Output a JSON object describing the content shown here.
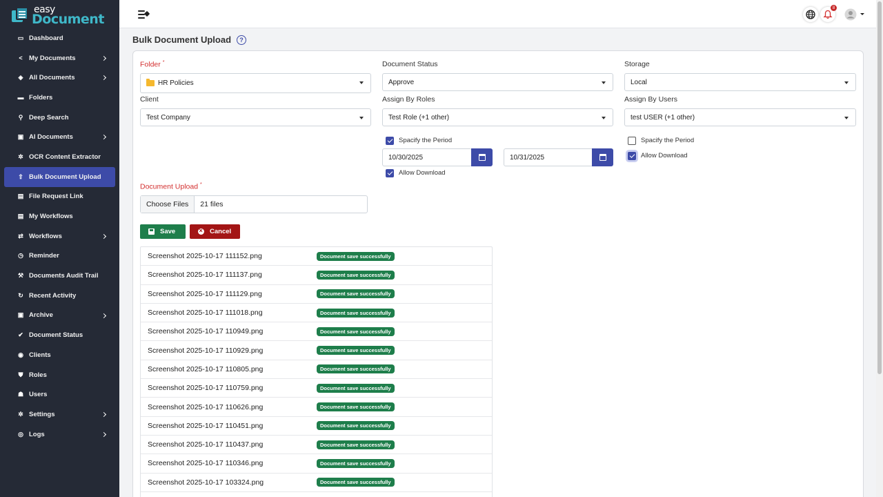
{
  "app": {
    "logo_small": "easy",
    "logo_big": "Document"
  },
  "sidebar": {
    "items": [
      {
        "label": "Dashboard",
        "icon": "monitor-icon",
        "chevron": false
      },
      {
        "label": "My Documents",
        "icon": "share-icon",
        "chevron": true
      },
      {
        "label": "All Documents",
        "icon": "layers-icon",
        "chevron": true
      },
      {
        "label": "Folders",
        "icon": "folder-icon",
        "chevron": false
      },
      {
        "label": "Deep Search",
        "icon": "user-search-icon",
        "chevron": false
      },
      {
        "label": "AI Documents",
        "icon": "ai-document-icon",
        "chevron": true
      },
      {
        "label": "OCR Content Extractor",
        "icon": "gear-icon",
        "chevron": false
      },
      {
        "label": "Bulk Document Upload",
        "icon": "upload-icon",
        "chevron": false,
        "active": true
      },
      {
        "label": "File Request Link",
        "icon": "file-icon",
        "chevron": false
      },
      {
        "label": "My Workflows",
        "icon": "workflow-icon",
        "chevron": false
      },
      {
        "label": "Workflows",
        "icon": "repeat-icon",
        "chevron": true
      },
      {
        "label": "Reminder",
        "icon": "clock-icon",
        "chevron": false
      },
      {
        "label": "Documents Audit Trail",
        "icon": "gavel-icon",
        "chevron": false
      },
      {
        "label": "Recent Activity",
        "icon": "refresh-icon",
        "chevron": false
      },
      {
        "label": "Archive",
        "icon": "archive-icon",
        "chevron": true
      },
      {
        "label": "Document Status",
        "icon": "check-circle-icon",
        "chevron": false
      },
      {
        "label": "Clients",
        "icon": "user-circle-icon",
        "chevron": false
      },
      {
        "label": "Roles",
        "icon": "shield-icon",
        "chevron": false
      },
      {
        "label": "Users",
        "icon": "users-icon",
        "chevron": false
      },
      {
        "label": "Settings",
        "icon": "gear-icon",
        "chevron": true
      },
      {
        "label": "Logs",
        "icon": "eye-icon",
        "chevron": true
      }
    ]
  },
  "topbar": {
    "notification_count": "8"
  },
  "page": {
    "title": "Bulk Document Upload"
  },
  "form": {
    "folder_label": "Folder",
    "folder_value": "HR Policies",
    "status_label": "Document Status",
    "status_value": "Approve",
    "storage_label": "Storage",
    "storage_value": "Local",
    "client_label": "Client",
    "client_value": "Test Company",
    "roles_label": "Assign By Roles",
    "roles_value": "Test Role (+1 other)",
    "users_label": "Assign By Users",
    "users_value": "test USER (+1 other)",
    "roles_period_label": "Spacify the Period",
    "roles_period_checked": true,
    "start_date": "10/30/2025",
    "end_date": "10/31/2025",
    "roles_download_label": "Allow Download",
    "roles_download_checked": true,
    "users_period_label": "Spacify the Period",
    "users_period_checked": false,
    "users_download_label": "Allow Download",
    "users_download_checked": true,
    "upload_label": "Document Upload",
    "choose_files": "Choose Files",
    "files_count": "21 files",
    "required_mark": "*"
  },
  "actions": {
    "save": "Save",
    "cancel": "Cancel"
  },
  "results": [
    {
      "file": "Screenshot 2025-10-17 111152.png",
      "status": "Document save successfully"
    },
    {
      "file": "Screenshot 2025-10-17 111137.png",
      "status": "Document save successfully"
    },
    {
      "file": "Screenshot 2025-10-17 111129.png",
      "status": "Document save successfully"
    },
    {
      "file": "Screenshot 2025-10-17 111018.png",
      "status": "Document save successfully"
    },
    {
      "file": "Screenshot 2025-10-17 110949.png",
      "status": "Document save successfully"
    },
    {
      "file": "Screenshot 2025-10-17 110929.png",
      "status": "Document save successfully"
    },
    {
      "file": "Screenshot 2025-10-17 110805.png",
      "status": "Document save successfully"
    },
    {
      "file": "Screenshot 2025-10-17 110759.png",
      "status": "Document save successfully"
    },
    {
      "file": "Screenshot 2025-10-17 110626.png",
      "status": "Document save successfully"
    },
    {
      "file": "Screenshot 2025-10-17 110451.png",
      "status": "Document save successfully"
    },
    {
      "file": "Screenshot 2025-10-17 110437.png",
      "status": "Document save successfully"
    },
    {
      "file": "Screenshot 2025-10-17 110346.png",
      "status": "Document save successfully"
    },
    {
      "file": "Screenshot 2025-10-17 103324.png",
      "status": "Document save successfully"
    }
  ],
  "colors": {
    "sidebar_bg": "#252a36",
    "accent": "#3d4ba8",
    "success": "#1e7e4b",
    "danger": "#a31515",
    "logo": "#3fb8c9"
  }
}
